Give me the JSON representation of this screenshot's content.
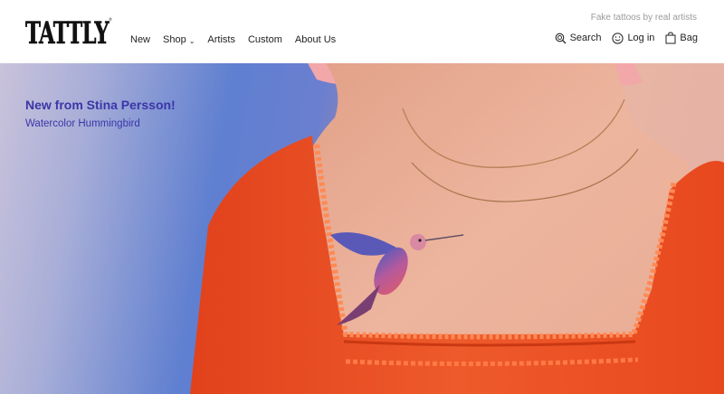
{
  "brand": {
    "logo_text": "TATTLY",
    "tagline": "Fake tattoos by real artists"
  },
  "nav": {
    "items": [
      {
        "label": "New"
      },
      {
        "label": "Shop",
        "dropdown": true
      },
      {
        "label": "Artists"
      },
      {
        "label": "Custom"
      },
      {
        "label": "About Us"
      }
    ]
  },
  "utility": {
    "search_label": "Search",
    "search_icon": "search-icon",
    "login_label": "Log in",
    "login_icon": "smiley-icon",
    "bag_label": "Bag",
    "bag_icon": "shopping-bag-icon"
  },
  "hero": {
    "headline": "New from Stina Persson!",
    "subheadline": "Watercolor Hummingbird",
    "accent_color": "#3b36a8",
    "image_alt": "Person in an orange ruffled top wearing a watercolor hummingbird temporary tattoo on the chest"
  }
}
